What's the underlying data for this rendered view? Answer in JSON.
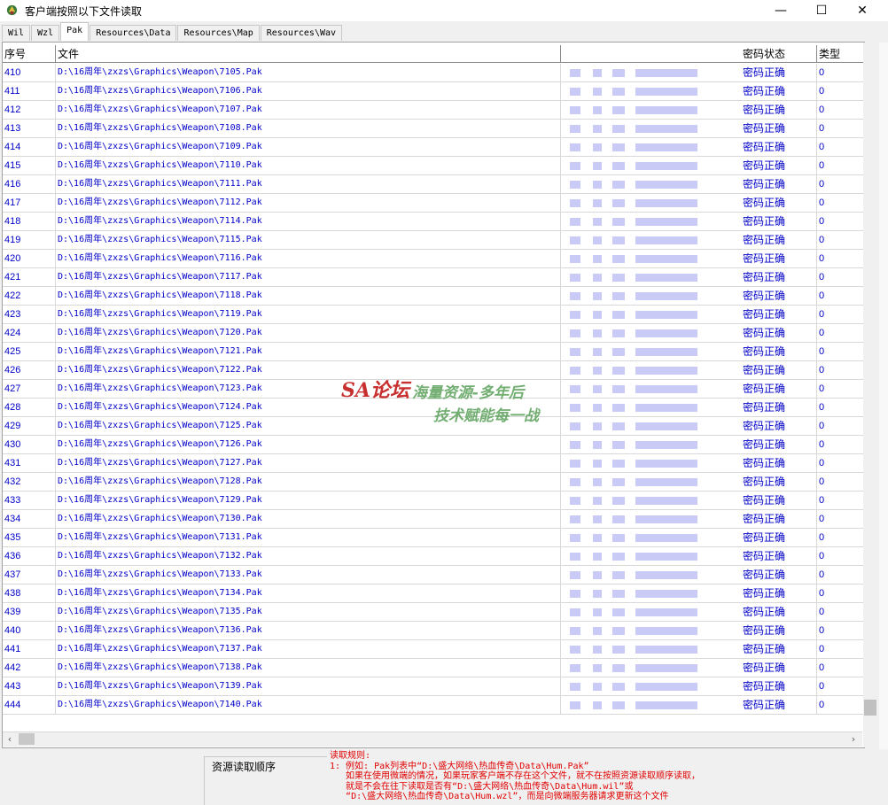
{
  "window": {
    "title": "客户端按照以下文件读取",
    "minimize": "—",
    "maximize": "☐",
    "close": "✕"
  },
  "tabs": [
    "Wil",
    "Wzl",
    "Pak",
    "Resources\\Data",
    "Resources\\Map",
    "Resources\\Wav"
  ],
  "active_tab": "Pak",
  "columns": {
    "id": "序号",
    "file": "文件",
    "status": "密码状态",
    "type": "类型"
  },
  "rows": [
    {
      "id": "410",
      "file": "D:\\16周年\\zxzs\\Graphics\\Weapon\\7105.Pak",
      "status": "密码正确",
      "type": "0"
    },
    {
      "id": "411",
      "file": "D:\\16周年\\zxzs\\Graphics\\Weapon\\7106.Pak",
      "status": "密码正确",
      "type": "0"
    },
    {
      "id": "412",
      "file": "D:\\16周年\\zxzs\\Graphics\\Weapon\\7107.Pak",
      "status": "密码正确",
      "type": "0"
    },
    {
      "id": "413",
      "file": "D:\\16周年\\zxzs\\Graphics\\Weapon\\7108.Pak",
      "status": "密码正确",
      "type": "0"
    },
    {
      "id": "414",
      "file": "D:\\16周年\\zxzs\\Graphics\\Weapon\\7109.Pak",
      "status": "密码正确",
      "type": "0"
    },
    {
      "id": "415",
      "file": "D:\\16周年\\zxzs\\Graphics\\Weapon\\7110.Pak",
      "status": "密码正确",
      "type": "0"
    },
    {
      "id": "416",
      "file": "D:\\16周年\\zxzs\\Graphics\\Weapon\\7111.Pak",
      "status": "密码正确",
      "type": "0"
    },
    {
      "id": "417",
      "file": "D:\\16周年\\zxzs\\Graphics\\Weapon\\7112.Pak",
      "status": "密码正确",
      "type": "0"
    },
    {
      "id": "418",
      "file": "D:\\16周年\\zxzs\\Graphics\\Weapon\\7114.Pak",
      "status": "密码正确",
      "type": "0"
    },
    {
      "id": "419",
      "file": "D:\\16周年\\zxzs\\Graphics\\Weapon\\7115.Pak",
      "status": "密码正确",
      "type": "0"
    },
    {
      "id": "420",
      "file": "D:\\16周年\\zxzs\\Graphics\\Weapon\\7116.Pak",
      "status": "密码正确",
      "type": "0"
    },
    {
      "id": "421",
      "file": "D:\\16周年\\zxzs\\Graphics\\Weapon\\7117.Pak",
      "status": "密码正确",
      "type": "0"
    },
    {
      "id": "422",
      "file": "D:\\16周年\\zxzs\\Graphics\\Weapon\\7118.Pak",
      "status": "密码正确",
      "type": "0"
    },
    {
      "id": "423",
      "file": "D:\\16周年\\zxzs\\Graphics\\Weapon\\7119.Pak",
      "status": "密码正确",
      "type": "0"
    },
    {
      "id": "424",
      "file": "D:\\16周年\\zxzs\\Graphics\\Weapon\\7120.Pak",
      "status": "密码正确",
      "type": "0"
    },
    {
      "id": "425",
      "file": "D:\\16周年\\zxzs\\Graphics\\Weapon\\7121.Pak",
      "status": "密码正确",
      "type": "0"
    },
    {
      "id": "426",
      "file": "D:\\16周年\\zxzs\\Graphics\\Weapon\\7122.Pak",
      "status": "密码正确",
      "type": "0"
    },
    {
      "id": "427",
      "file": "D:\\16周年\\zxzs\\Graphics\\Weapon\\7123.Pak",
      "status": "密码正确",
      "type": "0"
    },
    {
      "id": "428",
      "file": "D:\\16周年\\zxzs\\Graphics\\Weapon\\7124.Pak",
      "status": "密码正确",
      "type": "0"
    },
    {
      "id": "429",
      "file": "D:\\16周年\\zxzs\\Graphics\\Weapon\\7125.Pak",
      "status": "密码正确",
      "type": "0"
    },
    {
      "id": "430",
      "file": "D:\\16周年\\zxzs\\Graphics\\Weapon\\7126.Pak",
      "status": "密码正确",
      "type": "0"
    },
    {
      "id": "431",
      "file": "D:\\16周年\\zxzs\\Graphics\\Weapon\\7127.Pak",
      "status": "密码正确",
      "type": "0"
    },
    {
      "id": "432",
      "file": "D:\\16周年\\zxzs\\Graphics\\Weapon\\7128.Pak",
      "status": "密码正确",
      "type": "0"
    },
    {
      "id": "433",
      "file": "D:\\16周年\\zxzs\\Graphics\\Weapon\\7129.Pak",
      "status": "密码正确",
      "type": "0"
    },
    {
      "id": "434",
      "file": "D:\\16周年\\zxzs\\Graphics\\Weapon\\7130.Pak",
      "status": "密码正确",
      "type": "0"
    },
    {
      "id": "435",
      "file": "D:\\16周年\\zxzs\\Graphics\\Weapon\\7131.Pak",
      "status": "密码正确",
      "type": "0"
    },
    {
      "id": "436",
      "file": "D:\\16周年\\zxzs\\Graphics\\Weapon\\7132.Pak",
      "status": "密码正确",
      "type": "0"
    },
    {
      "id": "437",
      "file": "D:\\16周年\\zxzs\\Graphics\\Weapon\\7133.Pak",
      "status": "密码正确",
      "type": "0"
    },
    {
      "id": "438",
      "file": "D:\\16周年\\zxzs\\Graphics\\Weapon\\7134.Pak",
      "status": "密码正确",
      "type": "0"
    },
    {
      "id": "439",
      "file": "D:\\16周年\\zxzs\\Graphics\\Weapon\\7135.Pak",
      "status": "密码正确",
      "type": "0"
    },
    {
      "id": "440",
      "file": "D:\\16周年\\zxzs\\Graphics\\Weapon\\7136.Pak",
      "status": "密码正确",
      "type": "0"
    },
    {
      "id": "441",
      "file": "D:\\16周年\\zxzs\\Graphics\\Weapon\\7137.Pak",
      "status": "密码正确",
      "type": "0"
    },
    {
      "id": "442",
      "file": "D:\\16周年\\zxzs\\Graphics\\Weapon\\7138.Pak",
      "status": "密码正确",
      "type": "0"
    },
    {
      "id": "443",
      "file": "D:\\16周年\\zxzs\\Graphics\\Weapon\\7139.Pak",
      "status": "密码正确",
      "type": "0"
    },
    {
      "id": "444",
      "file": "D:\\16周年\\zxzs\\Graphics\\Weapon\\7140.Pak",
      "status": "密码正确",
      "type": "0"
    }
  ],
  "bottom": {
    "order_label": "资源读取顺序",
    "rules": [
      "读取规则:",
      "1: 例如: Pak列表中“D:\\盛大网络\\热血传奇\\Data\\Hum.Pak”",
      "   如果在使用微端的情况，如果玩家客户端不存在这个文件，就不在按照资源读取顺序读取，",
      "   就是不会在往下读取是否有“D:\\盛大网络\\热血传奇\\Data\\Hum.wil”或",
      "   “D:\\盛大网络\\热血传奇\\Data\\Hum.wzl”，而是向微端服务器请求更新这个文件"
    ]
  },
  "watermark": {
    "logo": "SA论坛",
    "line1": "海量资源-多年后",
    "line2": "技术赋能每一战"
  },
  "icons": {
    "app": "app-icon",
    "left_arrow": "‹",
    "right_arrow": "›"
  },
  "colors": {
    "link_blue": "#0000c8",
    "rule_red": "#e00000"
  }
}
